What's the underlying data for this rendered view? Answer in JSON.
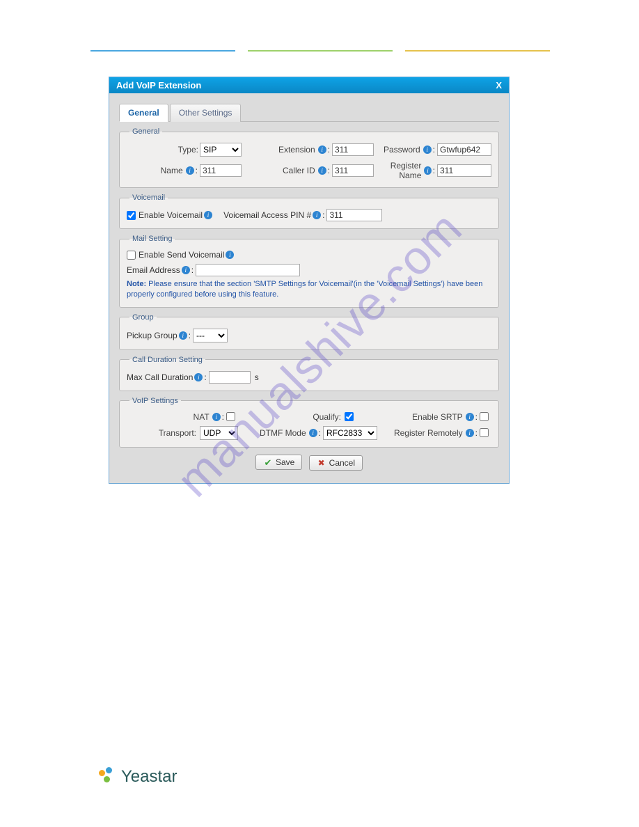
{
  "dialog": {
    "title": "Add VoIP Extension",
    "tabs": {
      "general": "General",
      "other": "Other Settings"
    },
    "general": {
      "legend": "General",
      "type_label": "Type:",
      "type_value": "SIP",
      "extension_label": "Extension",
      "extension_value": "311",
      "password_label": "Password",
      "password_value": "Gtwfup642",
      "name_label": "Name",
      "name_value": "311",
      "callerid_label": "Caller ID",
      "callerid_value": "311",
      "register_name_label": "Register Name",
      "register_name_value": "311"
    },
    "voicemail": {
      "legend": "Voicemail",
      "enable_label": "Enable Voicemail",
      "enable_checked": true,
      "pin_label": "Voicemail Access PIN #",
      "pin_value": "311"
    },
    "mail": {
      "legend": "Mail Setting",
      "enable_label": "Enable Send Voicemail",
      "enable_checked": false,
      "email_label": "Email Address",
      "email_value": "",
      "note_bold": "Note:",
      "note_text": " Please ensure that the section 'SMTP Settings for Voicemail'(in the 'Voicemail Settings') have been properly configured before using this feature."
    },
    "group": {
      "legend": "Group",
      "pickup_label": "Pickup Group",
      "pickup_value": "---"
    },
    "duration": {
      "legend": "Call Duration Setting",
      "max_label": "Max Call Duration",
      "max_value": "",
      "unit": "s"
    },
    "voip": {
      "legend": "VoIP Settings",
      "nat_label": "NAT",
      "nat_checked": false,
      "qualify_label": "Qualify:",
      "qualify_checked": true,
      "srtp_label": "Enable SRTP",
      "srtp_checked": false,
      "transport_label": "Transport:",
      "transport_value": "UDP",
      "dtmf_label": "DTMF Mode",
      "dtmf_value": "RFC2833",
      "remote_label": "Register Remotely",
      "remote_checked": false
    },
    "buttons": {
      "save": "Save",
      "cancel": "Cancel"
    }
  },
  "watermark": "manualshive.com",
  "brand": "Yeastar"
}
